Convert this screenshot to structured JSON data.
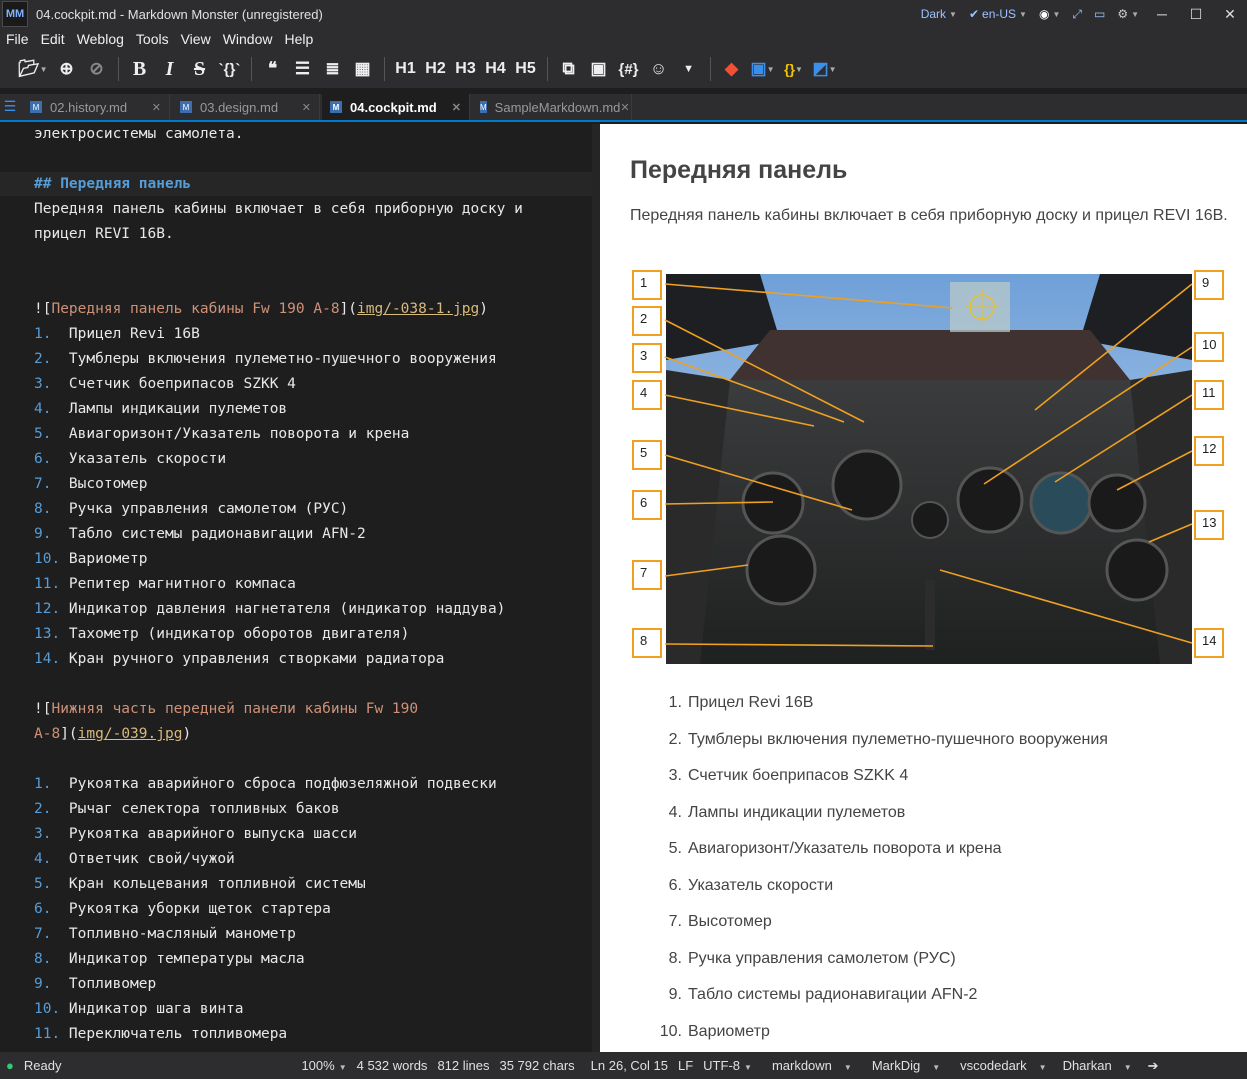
{
  "titlebar": {
    "logo": "MM",
    "title": "04.cockpit.md  -  Markdown Monster  (unregistered)",
    "theme": "Dark",
    "language": "en-US"
  },
  "menu": [
    "File",
    "Edit",
    "Weblog",
    "Tools",
    "View",
    "Window",
    "Help"
  ],
  "toolbar": {
    "bold": "B",
    "italic": "I",
    "strike": "S",
    "code": "`{}`",
    "quote": "❝",
    "h1": "H1",
    "h2": "H2",
    "h3": "H3",
    "h4": "H4",
    "h5": "H5",
    "snippet": "{#}"
  },
  "tabs": [
    {
      "label": "02.history.md",
      "active": false
    },
    {
      "label": "03.design.md",
      "active": false
    },
    {
      "label": "04.cockpit.md",
      "active": true
    },
    {
      "label": "SampleMarkdown.md",
      "active": false
    }
  ],
  "editor": {
    "line_top": "электросистемы самолета.",
    "heading": "## Передняя панель",
    "para1": "Передняя панель кабины включает в себя приборную доску и",
    "para2": "прицел REVI 16В.",
    "image1_alt": "Передняя панель кабины Fw 190 A-8",
    "image1_url": "img/-038-1.jpg",
    "list1": [
      "Прицел Revi 16В",
      "Тумблеры включения пулеметно-пушечного вооружения",
      "Счетчик боеприпасов SZKK 4",
      "Лампы индикации пулеметов",
      "Авиагоризонт/Указатель поворота и крена",
      "Указатель скорости",
      "Высотомер",
      "Ручка управления самолетом (РУС)",
      "Табло системы радионавигации AFN-2",
      "Вариометр",
      "Репитер магнитного компаса",
      "Индикатор давления нагнетателя (индикатор наддува)",
      "Тахометр (индикатор оборотов двигателя)",
      "Кран ручного управления створками радиатора"
    ],
    "image2_alt_a": "Нижняя часть передней панели кабины Fw 190",
    "image2_alt_b": "A-8",
    "image2_url": "img/-039.jpg",
    "list2": [
      "Рукоятка аварийного сброса подфюзеляжной подвески",
      "Рычаг селектора топливных баков",
      "Рукоятка аварийного выпуска шасси",
      "Ответчик свой/чужой",
      "Кран кольцевания топливной системы",
      "Рукоятка уборки щеток стартера",
      "Топливно-масляный манометр",
      "Индикатор температуры масла",
      "Топливомер",
      "Индикатор шага винта",
      "Переключатель топливомера"
    ]
  },
  "preview": {
    "title": "Передняя панель",
    "paragraph": "Передняя панель кабины включает в себя приборную доску и прицел REVI 16В.",
    "callouts_left": [
      "1",
      "2",
      "3",
      "4",
      "5",
      "6",
      "7",
      "8"
    ],
    "callouts_right": [
      "9",
      "10",
      "11",
      "12",
      "13",
      "14"
    ],
    "list": [
      "Прицел Revi 16В",
      "Тумблеры включения пулеметно-пушечного вооружения",
      "Счетчик боеприпасов SZKK 4",
      "Лампы индикации пулеметов",
      "Авиагоризонт/Указатель поворота и крена",
      "Указатель скорости",
      "Высотомер",
      "Ручка управления самолетом (РУС)",
      "Табло системы радионавигации AFN-2",
      "Вариометр"
    ]
  },
  "statusbar": {
    "status": "Ready",
    "zoom": "100%",
    "words": "4 532 words",
    "lines": "812 lines",
    "chars": "35 792 chars",
    "position": "Ln 26, Col 15",
    "line_ending": "LF",
    "encoding": "UTF-8",
    "syntax": "markdown",
    "parser": "MarkDig",
    "editor_theme": "vscodedark",
    "preview_theme": "Dharkan"
  },
  "colors": {
    "accent": "#007acc",
    "heading": "#569cd6",
    "link_text": "#ce9178",
    "url": "#d7ba7d",
    "callout_border": "#f0a020"
  }
}
